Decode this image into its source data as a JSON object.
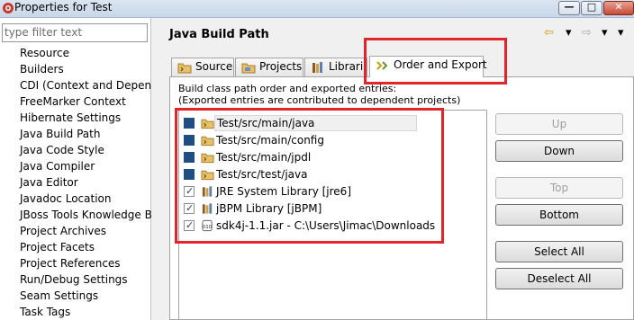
{
  "window": {
    "title": "Properties for Test",
    "minimize": "—",
    "maximize": "□",
    "close": "✕"
  },
  "filter": {
    "placeholder": "type filter text"
  },
  "tree": [
    {
      "label": "Resource"
    },
    {
      "label": "Builders"
    },
    {
      "label": "CDI (Context and Dependen"
    },
    {
      "label": "FreeMarker Context"
    },
    {
      "label": "Hibernate Settings"
    },
    {
      "label": "Java Build Path"
    },
    {
      "label": "Java Code Style"
    },
    {
      "label": "Java Compiler"
    },
    {
      "label": "Java Editor"
    },
    {
      "label": "Javadoc Location"
    },
    {
      "label": "JBoss Tools Knowledge Bas"
    },
    {
      "label": "Project Archives"
    },
    {
      "label": "Project Facets"
    },
    {
      "label": "Project References"
    },
    {
      "label": "Run/Debug Settings"
    },
    {
      "label": "Seam Settings"
    },
    {
      "label": "Task Tags"
    }
  ],
  "page": {
    "title": "Java Build Path",
    "nav_back": "⇦",
    "nav_back_menu": "▾",
    "nav_forward": "⇨",
    "nav_forward_menu": "▾",
    "view_menu": "▾"
  },
  "tabs": [
    {
      "label": "Source",
      "icon": "source-folder-icon"
    },
    {
      "label": "Projects",
      "icon": "projects-icon"
    },
    {
      "label": "Libraries",
      "icon": "libraries-icon"
    },
    {
      "label": "Order and Export",
      "icon": "order-export-icon",
      "active": true
    }
  ],
  "order_export": {
    "description_line1": "Build class path order and exported entries:",
    "description_line2": "(Exported entries are contributed to dependent projects)",
    "entries": [
      {
        "label": "Test/src/main/java",
        "checked": false,
        "icon": "source-folder-icon"
      },
      {
        "label": "Test/src/main/config",
        "checked": false,
        "icon": "source-folder-icon"
      },
      {
        "label": "Test/src/main/jpdl",
        "checked": false,
        "icon": "source-folder-icon"
      },
      {
        "label": "Test/src/test/java",
        "checked": false,
        "icon": "source-folder-icon"
      },
      {
        "label": "JRE System Library [jre6]",
        "checked": true,
        "icon": "library-icon"
      },
      {
        "label": "jBPM Library [jBPM]",
        "checked": true,
        "icon": "library-icon"
      },
      {
        "label": "sdk4j-1.1.jar - C:\\Users\\Jimac\\Downloads",
        "checked": true,
        "icon": "jar-icon"
      }
    ],
    "buttons": {
      "up": "Up",
      "down": "Down",
      "top": "Top",
      "bottom": "Bottom",
      "select_all": "Select All",
      "deselect_all": "Deselect All"
    }
  },
  "colors": {
    "annotation_red": "#e0262b",
    "selection_blue": "#1f4f82"
  }
}
